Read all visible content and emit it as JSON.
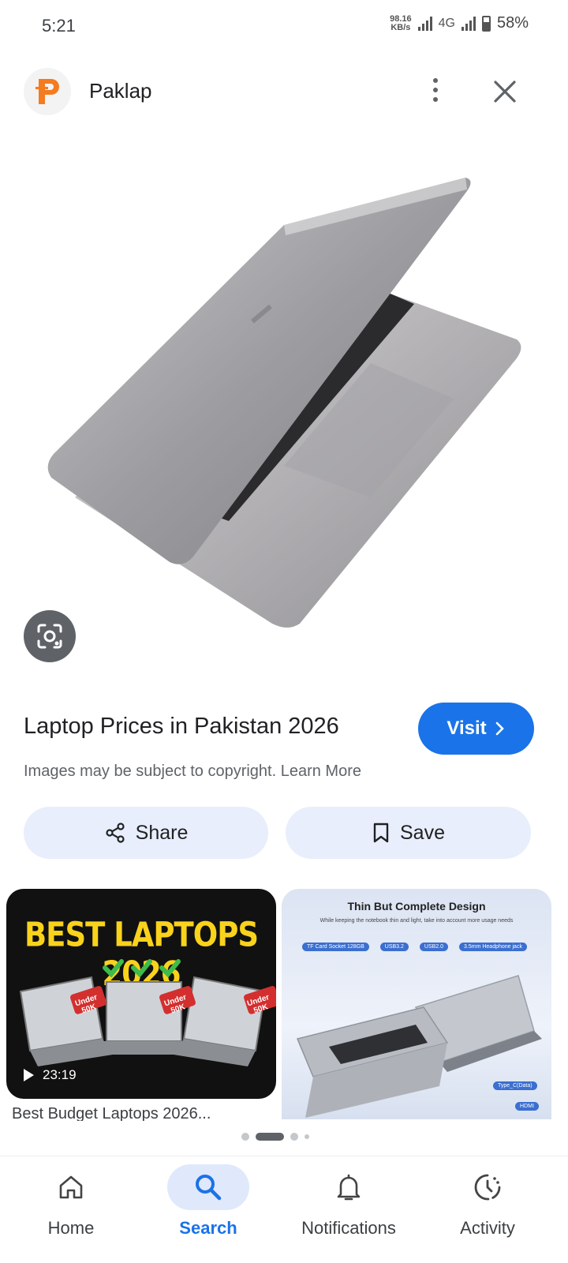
{
  "status_bar": {
    "time": "5:21",
    "net_speed_value": "98.16",
    "net_speed_unit": "KB/s",
    "network_type": "4G",
    "battery": "58%"
  },
  "header": {
    "site_name": "Paklap",
    "logo_icon": "paklap-logo-icon",
    "more_icon": "more-vert-icon",
    "close_icon": "close-icon"
  },
  "image": {
    "title": "Laptop Prices in Pakistan 2026",
    "visit_label": "Visit",
    "copyright_notice": "Images may be subject to copyright. Learn More",
    "lens_icon": "google-lens-icon"
  },
  "actions": {
    "share_label": "Share",
    "save_label": "Save"
  },
  "related": {
    "video": {
      "overlay_title": "BEST LAPTOPS 2026",
      "badges": [
        "Under 50K",
        "Under 50K",
        "Under 50K"
      ],
      "duration": "23:19",
      "caption": "Best Budget Laptops 2026..."
    },
    "design": {
      "heading": "Thin But Complete Design",
      "subheading": "While keeping the notebook thin and light, take into account more usage needs",
      "spec_tags": [
        "TF Card Socket 128GB",
        "USB3.2",
        "USB2.0",
        "3.5mm Headphone jack"
      ],
      "port_tags": [
        "Type_C(Data)",
        "HDMI"
      ]
    }
  },
  "pager": {
    "count": 4,
    "active_index": 1
  },
  "bottom_nav": {
    "items": [
      {
        "label": "Home",
        "icon": "home-icon"
      },
      {
        "label": "Search",
        "icon": "search-icon",
        "active": true
      },
      {
        "label": "Notifications",
        "icon": "bell-icon"
      },
      {
        "label": "Activity",
        "icon": "activity-icon"
      }
    ]
  },
  "colors": {
    "accent": "#1a73e8",
    "chip_background": "#e8eefb",
    "active_nav_background": "#e0e8fb",
    "video_title_yellow": "#f9d21b",
    "badge_red": "#d32f2f"
  }
}
